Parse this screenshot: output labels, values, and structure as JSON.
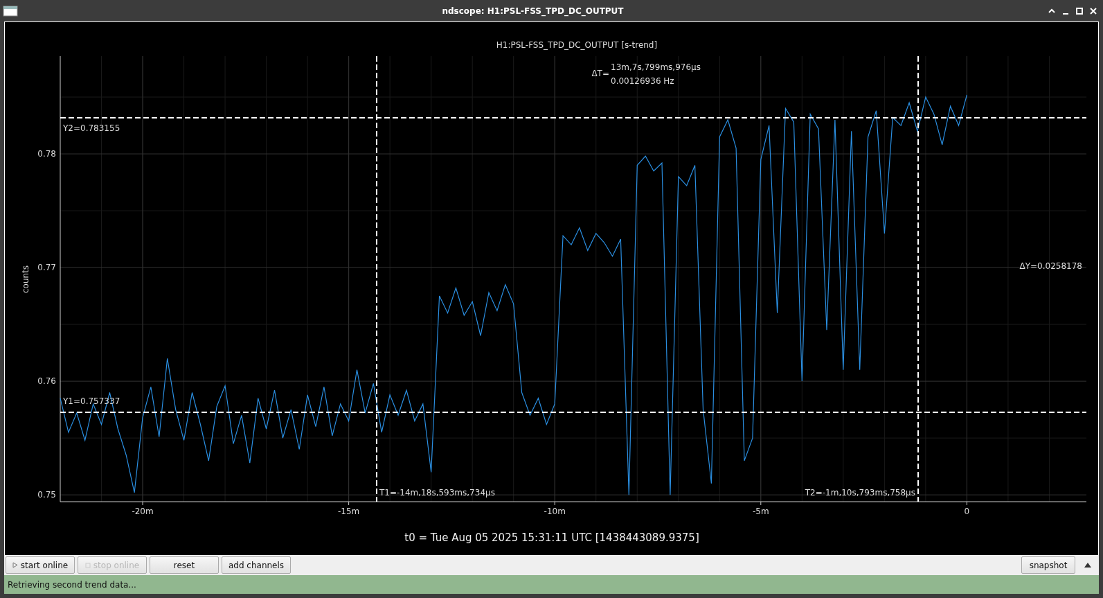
{
  "window": {
    "title": "ndscope: H1:PSL-FSS_TPD_DC_OUTPUT"
  },
  "plot": {
    "chart_data": {
      "type": "line",
      "title": "H1:PSL-FSS_TPD_DC_OUTPUT [s-trend]",
      "ylabel": "counts",
      "xticks": [
        {
          "value": -20,
          "label": "-20m"
        },
        {
          "value": -15,
          "label": "-15m"
        },
        {
          "value": -10,
          "label": "-10m"
        },
        {
          "value": -5,
          "label": "-5m"
        },
        {
          "value": 0,
          "label": "0"
        }
      ],
      "yticks": [
        0.78,
        0.77,
        0.76,
        0.75
      ],
      "xlim": [
        -22.0,
        2.9
      ],
      "ylim": [
        0.7494,
        0.7886
      ],
      "grid": true,
      "x": [
        -22.0,
        -21.8,
        -21.6,
        -21.4,
        -21.2,
        -21.0,
        -20.8,
        -20.6,
        -20.4,
        -20.2,
        -20.0,
        -19.8,
        -19.6,
        -19.4,
        -19.2,
        -19.0,
        -18.8,
        -18.6,
        -18.4,
        -18.2,
        -18.0,
        -17.8,
        -17.6,
        -17.4,
        -17.2,
        -17.0,
        -16.8,
        -16.6,
        -16.4,
        -16.2,
        -16.0,
        -15.8,
        -15.6,
        -15.4,
        -15.2,
        -15.0,
        -14.8,
        -14.6,
        -14.4,
        -14.2,
        -14.0,
        -13.8,
        -13.6,
        -13.4,
        -13.2,
        -13.0,
        -12.8,
        -12.6,
        -12.4,
        -12.2,
        -12.0,
        -11.8,
        -11.6,
        -11.4,
        -11.2,
        -11.0,
        -10.8,
        -10.6,
        -10.4,
        -10.2,
        -10.0,
        -9.8,
        -9.6,
        -9.4,
        -9.2,
        -9.0,
        -8.8,
        -8.6,
        -8.4,
        -8.2,
        -8.0,
        -7.8,
        -7.6,
        -7.4,
        -7.2,
        -7.0,
        -6.8,
        -6.6,
        -6.4,
        -6.2,
        -6.0,
        -5.8,
        -5.6,
        -5.4,
        -5.2,
        -5.0,
        -4.8,
        -4.6,
        -4.4,
        -4.2,
        -4.0,
        -3.8,
        -3.6,
        -3.4,
        -3.2,
        -3.0,
        -2.8,
        -2.6,
        -2.4,
        -2.2,
        -2.0,
        -1.8,
        -1.6,
        -1.4,
        -1.2,
        -1.0,
        -0.8,
        -0.6,
        -0.4,
        -0.2,
        0.0
      ],
      "series": [
        {
          "color": "#2a8ee0",
          "values": [
            0.7585,
            0.7555,
            0.7572,
            0.7548,
            0.758,
            0.7562,
            0.759,
            0.7558,
            0.7535,
            0.7502,
            0.7568,
            0.7595,
            0.7551,
            0.762,
            0.7575,
            0.7548,
            0.759,
            0.7562,
            0.753,
            0.7578,
            0.7596,
            0.7545,
            0.757,
            0.7528,
            0.7585,
            0.7558,
            0.7592,
            0.755,
            0.7575,
            0.754,
            0.7588,
            0.756,
            0.7595,
            0.7552,
            0.758,
            0.7565,
            0.761,
            0.7572,
            0.7598,
            0.7555,
            0.7588,
            0.757,
            0.7592,
            0.7565,
            0.758,
            0.752,
            0.7675,
            0.766,
            0.7682,
            0.7658,
            0.767,
            0.764,
            0.7678,
            0.7662,
            0.7685,
            0.7668,
            0.759,
            0.757,
            0.7585,
            0.7562,
            0.758,
            0.7728,
            0.772,
            0.7735,
            0.7715,
            0.773,
            0.7722,
            0.771,
            0.7725,
            0.75,
            0.779,
            0.7798,
            0.7785,
            0.7792,
            0.75,
            0.778,
            0.7772,
            0.779,
            0.7575,
            0.751,
            0.7815,
            0.783,
            0.7805,
            0.753,
            0.755,
            0.7795,
            0.7825,
            0.766,
            0.784,
            0.7828,
            0.76,
            0.7835,
            0.7822,
            0.7645,
            0.783,
            0.761,
            0.782,
            0.761,
            0.7815,
            0.7838,
            0.773,
            0.7832,
            0.7825,
            0.7845,
            0.782,
            0.785,
            0.7835,
            0.7808,
            0.7842,
            0.7825,
            0.7852
          ]
        }
      ]
    },
    "cursors": {
      "t1": "T1=-14m,18s,593ms,734µs",
      "t2": "T2=-1m,10s,793ms,758µs",
      "y1": "Y1=0.757337",
      "y2": "Y2=0.783155",
      "dt_label": "ΔT=",
      "dt_value": "13m,7s,799ms,976µs",
      "dt_freq": "0.00126936 Hz",
      "dy": "ΔY=0.0258178"
    },
    "t0": "t0 = Tue Aug 05 2025 15:31:11 UTC [1438443089.9375]"
  },
  "toolbar": [
    {
      "label": "start online",
      "kind": "play",
      "disabled": false
    },
    {
      "label": "stop online",
      "kind": "stop",
      "disabled": true
    },
    {
      "label": "reset",
      "kind": "plain",
      "disabled": false
    },
    {
      "label": "add channels",
      "kind": "plain",
      "disabled": false
    }
  ],
  "snapshot": {
    "label": "snapshot"
  },
  "status_bar": "Retrieving second trend data..."
}
